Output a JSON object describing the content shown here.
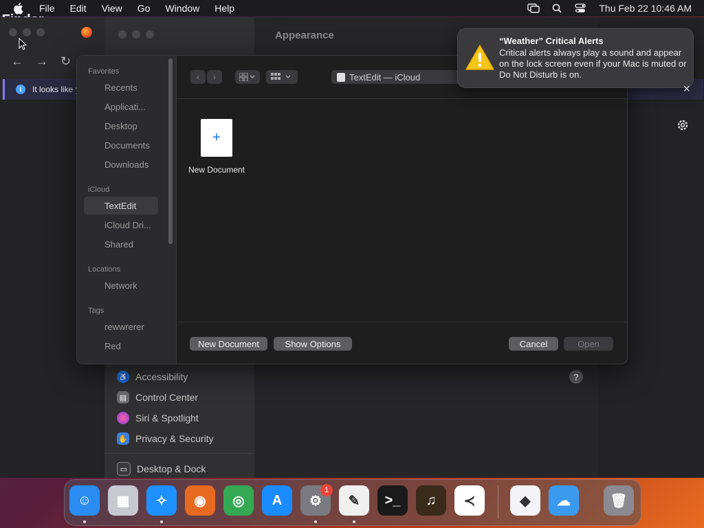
{
  "menubar": {
    "app_name": "Finder",
    "items": [
      "File",
      "Edit",
      "View",
      "Go",
      "Window",
      "Help"
    ],
    "clock": "Thu Feb 22  10:46 AM"
  },
  "browser": {
    "info_text": "It looks like y"
  },
  "settings": {
    "title": "Appearance",
    "items": [
      {
        "label": "Accessibility",
        "color": "#1a6fe0"
      },
      {
        "label": "Control Center",
        "color": "#6a6a6c"
      },
      {
        "label": "Siri & Spotlight",
        "color": "#c03fd0"
      },
      {
        "label": "Privacy & Security",
        "color": "#3a7fe0"
      },
      {
        "label": "Desktop & Dock",
        "color": "#3a3a3c"
      }
    ],
    "help": "?"
  },
  "dialog": {
    "sidebar": {
      "favorites_header": "Favorites",
      "favorites": [
        "Recents",
        "Applicati...",
        "Desktop",
        "Documents",
        "Downloads"
      ],
      "icloud_header": "iCloud",
      "icloud": [
        "TextEdit",
        "iCloud Dri...",
        "Shared"
      ],
      "locations_header": "Locations",
      "locations": [
        "Network"
      ],
      "tags_header": "Tags",
      "tags": [
        "rewwrerer",
        "Red"
      ]
    },
    "path": "TextEdit — iCloud",
    "document": {
      "icon": "+",
      "label": "New Document"
    },
    "buttons": {
      "new_document": "New Document",
      "show_options": "Show Options",
      "cancel": "Cancel",
      "open": "Open"
    }
  },
  "notification": {
    "title": "“Weather” Critical Alerts",
    "body": "Critical alerts always play a sound and appear on the lock screen even if your Mac is muted or Do Not Disturb is on."
  },
  "dock": {
    "apps": [
      {
        "name": "finder-icon",
        "color": "#2a8cf0",
        "glyph": "☺"
      },
      {
        "name": "launchpad-icon",
        "color": "#c8c8d0",
        "glyph": "▦"
      },
      {
        "name": "safari-icon",
        "color": "#1e90ff",
        "glyph": "✧"
      },
      {
        "name": "firefox-icon",
        "color": "#e86a20",
        "glyph": "◉"
      },
      {
        "name": "chrome-icon",
        "color": "#34a853",
        "glyph": "◎"
      },
      {
        "name": "app-store-icon",
        "color": "#1a8cff",
        "glyph": "A"
      },
      {
        "name": "system-settings-icon",
        "color": "#7a7a80",
        "glyph": "⚙"
      },
      {
        "name": "textedit-icon",
        "color": "#f0f0f0",
        "glyph": "✎"
      },
      {
        "name": "terminal-icon",
        "color": "#1a1a1a",
        "glyph": ">_"
      },
      {
        "name": "garageband-icon",
        "color": "#3a2a1a",
        "glyph": "♫"
      },
      {
        "name": "vscode-icon",
        "color": "#ffffff",
        "glyph": "≺"
      },
      {
        "name": "visual-studio-icon",
        "color": "#f4f4f8",
        "glyph": "◆"
      },
      {
        "name": "weather-icon",
        "color": "#3a9af0",
        "glyph": "☁"
      },
      {
        "name": "trash-icon",
        "color": "#8a8a90",
        "glyph": "🗑"
      }
    ],
    "settings_badge": "1"
  }
}
